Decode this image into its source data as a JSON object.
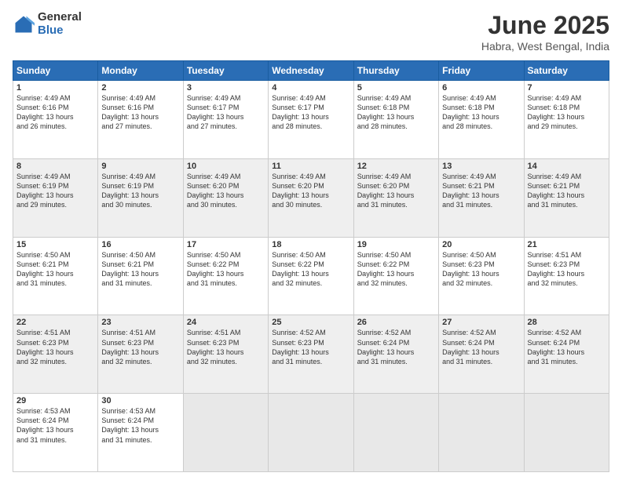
{
  "header": {
    "logo_general": "General",
    "logo_blue": "Blue",
    "title": "June 2025",
    "location": "Habra, West Bengal, India"
  },
  "weekdays": [
    "Sunday",
    "Monday",
    "Tuesday",
    "Wednesday",
    "Thursday",
    "Friday",
    "Saturday"
  ],
  "rows": [
    [
      {
        "day": "1",
        "info": "Sunrise: 4:49 AM\nSunset: 6:16 PM\nDaylight: 13 hours\nand 26 minutes."
      },
      {
        "day": "2",
        "info": "Sunrise: 4:49 AM\nSunset: 6:16 PM\nDaylight: 13 hours\nand 27 minutes."
      },
      {
        "day": "3",
        "info": "Sunrise: 4:49 AM\nSunset: 6:17 PM\nDaylight: 13 hours\nand 27 minutes."
      },
      {
        "day": "4",
        "info": "Sunrise: 4:49 AM\nSunset: 6:17 PM\nDaylight: 13 hours\nand 28 minutes."
      },
      {
        "day": "5",
        "info": "Sunrise: 4:49 AM\nSunset: 6:18 PM\nDaylight: 13 hours\nand 28 minutes."
      },
      {
        "day": "6",
        "info": "Sunrise: 4:49 AM\nSunset: 6:18 PM\nDaylight: 13 hours\nand 28 minutes."
      },
      {
        "day": "7",
        "info": "Sunrise: 4:49 AM\nSunset: 6:18 PM\nDaylight: 13 hours\nand 29 minutes."
      }
    ],
    [
      {
        "day": "8",
        "info": "Sunrise: 4:49 AM\nSunset: 6:19 PM\nDaylight: 13 hours\nand 29 minutes."
      },
      {
        "day": "9",
        "info": "Sunrise: 4:49 AM\nSunset: 6:19 PM\nDaylight: 13 hours\nand 30 minutes."
      },
      {
        "day": "10",
        "info": "Sunrise: 4:49 AM\nSunset: 6:20 PM\nDaylight: 13 hours\nand 30 minutes."
      },
      {
        "day": "11",
        "info": "Sunrise: 4:49 AM\nSunset: 6:20 PM\nDaylight: 13 hours\nand 30 minutes."
      },
      {
        "day": "12",
        "info": "Sunrise: 4:49 AM\nSunset: 6:20 PM\nDaylight: 13 hours\nand 31 minutes."
      },
      {
        "day": "13",
        "info": "Sunrise: 4:49 AM\nSunset: 6:21 PM\nDaylight: 13 hours\nand 31 minutes."
      },
      {
        "day": "14",
        "info": "Sunrise: 4:49 AM\nSunset: 6:21 PM\nDaylight: 13 hours\nand 31 minutes."
      }
    ],
    [
      {
        "day": "15",
        "info": "Sunrise: 4:50 AM\nSunset: 6:21 PM\nDaylight: 13 hours\nand 31 minutes."
      },
      {
        "day": "16",
        "info": "Sunrise: 4:50 AM\nSunset: 6:21 PM\nDaylight: 13 hours\nand 31 minutes."
      },
      {
        "day": "17",
        "info": "Sunrise: 4:50 AM\nSunset: 6:22 PM\nDaylight: 13 hours\nand 31 minutes."
      },
      {
        "day": "18",
        "info": "Sunrise: 4:50 AM\nSunset: 6:22 PM\nDaylight: 13 hours\nand 32 minutes."
      },
      {
        "day": "19",
        "info": "Sunrise: 4:50 AM\nSunset: 6:22 PM\nDaylight: 13 hours\nand 32 minutes."
      },
      {
        "day": "20",
        "info": "Sunrise: 4:50 AM\nSunset: 6:23 PM\nDaylight: 13 hours\nand 32 minutes."
      },
      {
        "day": "21",
        "info": "Sunrise: 4:51 AM\nSunset: 6:23 PM\nDaylight: 13 hours\nand 32 minutes."
      }
    ],
    [
      {
        "day": "22",
        "info": "Sunrise: 4:51 AM\nSunset: 6:23 PM\nDaylight: 13 hours\nand 32 minutes."
      },
      {
        "day": "23",
        "info": "Sunrise: 4:51 AM\nSunset: 6:23 PM\nDaylight: 13 hours\nand 32 minutes."
      },
      {
        "day": "24",
        "info": "Sunrise: 4:51 AM\nSunset: 6:23 PM\nDaylight: 13 hours\nand 32 minutes."
      },
      {
        "day": "25",
        "info": "Sunrise: 4:52 AM\nSunset: 6:23 PM\nDaylight: 13 hours\nand 31 minutes."
      },
      {
        "day": "26",
        "info": "Sunrise: 4:52 AM\nSunset: 6:24 PM\nDaylight: 13 hours\nand 31 minutes."
      },
      {
        "day": "27",
        "info": "Sunrise: 4:52 AM\nSunset: 6:24 PM\nDaylight: 13 hours\nand 31 minutes."
      },
      {
        "day": "28",
        "info": "Sunrise: 4:52 AM\nSunset: 6:24 PM\nDaylight: 13 hours\nand 31 minutes."
      }
    ],
    [
      {
        "day": "29",
        "info": "Sunrise: 4:53 AM\nSunset: 6:24 PM\nDaylight: 13 hours\nand 31 minutes."
      },
      {
        "day": "30",
        "info": "Sunrise: 4:53 AM\nSunset: 6:24 PM\nDaylight: 13 hours\nand 31 minutes."
      },
      {
        "day": "",
        "info": ""
      },
      {
        "day": "",
        "info": ""
      },
      {
        "day": "",
        "info": ""
      },
      {
        "day": "",
        "info": ""
      },
      {
        "day": "",
        "info": ""
      }
    ]
  ]
}
